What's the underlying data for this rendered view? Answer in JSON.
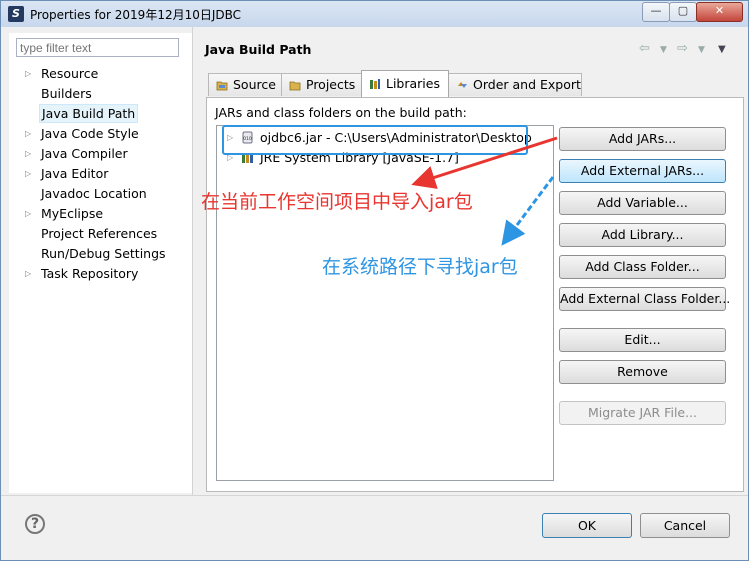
{
  "window": {
    "title": "Properties for 2019年12月10日JDBC",
    "controls": [
      "minimize-icon",
      "maximize-icon",
      "close-icon"
    ]
  },
  "left_panel": {
    "filter_placeholder": "type filter text",
    "items": [
      {
        "label": "Resource",
        "expandable": true
      },
      {
        "label": "Builders",
        "expandable": false
      },
      {
        "label": "Java Build Path",
        "expandable": false,
        "selected": true
      },
      {
        "label": "Java Code Style",
        "expandable": true
      },
      {
        "label": "Java Compiler",
        "expandable": true
      },
      {
        "label": "Java Editor",
        "expandable": true
      },
      {
        "label": "Javadoc Location",
        "expandable": false
      },
      {
        "label": "MyEclipse",
        "expandable": true
      },
      {
        "label": "Project References",
        "expandable": false
      },
      {
        "label": "Run/Debug Settings",
        "expandable": false
      },
      {
        "label": "Task Repository",
        "expandable": true
      }
    ]
  },
  "page": {
    "title": "Java Build Path",
    "tabs": [
      {
        "label": "Source",
        "icon": "source-folder-icon"
      },
      {
        "label": "Projects",
        "icon": "projects-icon"
      },
      {
        "label": "Libraries",
        "icon": "libraries-icon",
        "active": true
      },
      {
        "label": "Order and Export",
        "icon": "order-export-icon"
      }
    ],
    "list_label": "JARs and class folders on the build path:",
    "entries": [
      {
        "label": "ojdbc6.jar - C:\\Users\\Administrator\\Desktop",
        "icon": "jar-icon"
      },
      {
        "label": "JRE System Library [JavaSE-1.7]",
        "icon": "library-icon"
      }
    ],
    "buttons": [
      {
        "label": "Add JARs...",
        "state": "normal"
      },
      {
        "label": "Add External JARs...",
        "state": "focused"
      },
      {
        "label": "Add Variable...",
        "state": "normal"
      },
      {
        "label": "Add Library...",
        "state": "normal"
      },
      {
        "label": "Add Class Folder...",
        "state": "normal"
      },
      {
        "label": "Add External Class Folder...",
        "state": "normal"
      },
      {
        "label": "Edit...",
        "state": "normal"
      },
      {
        "label": "Remove",
        "state": "normal"
      },
      {
        "label": "Migrate JAR File...",
        "state": "disabled"
      }
    ]
  },
  "annotations": {
    "red_text": "在当前工作空间项目中导入jar包",
    "blue_text": "在系统路径下寻找jar包",
    "red_color": "#e8352f",
    "blue_color": "#2e95e3"
  },
  "footer": {
    "ok_label": "OK",
    "cancel_label": "Cancel"
  }
}
